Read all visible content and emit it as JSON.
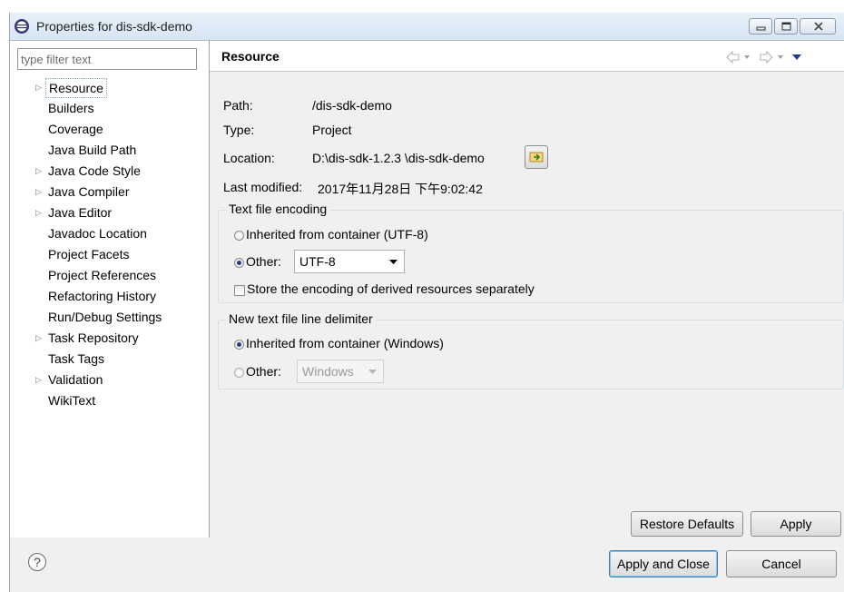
{
  "window": {
    "title": "Properties for dis-sdk-demo"
  },
  "filter": {
    "placeholder": "type filter text"
  },
  "tree": [
    {
      "label": "Resource",
      "expandable": true,
      "selected": true
    },
    {
      "label": "Builders",
      "expandable": false
    },
    {
      "label": "Coverage",
      "expandable": false
    },
    {
      "label": "Java Build Path",
      "expandable": false
    },
    {
      "label": "Java Code Style",
      "expandable": true
    },
    {
      "label": "Java Compiler",
      "expandable": true
    },
    {
      "label": "Java Editor",
      "expandable": true
    },
    {
      "label": "Javadoc Location",
      "expandable": false
    },
    {
      "label": "Project Facets",
      "expandable": false
    },
    {
      "label": "Project References",
      "expandable": false
    },
    {
      "label": "Refactoring History",
      "expandable": false
    },
    {
      "label": "Run/Debug Settings",
      "expandable": false
    },
    {
      "label": "Task Repository",
      "expandable": true
    },
    {
      "label": "Task Tags",
      "expandable": false
    },
    {
      "label": "Validation",
      "expandable": true
    },
    {
      "label": "WikiText",
      "expandable": false
    }
  ],
  "page": {
    "title": "Resource"
  },
  "info": {
    "path_label": "Path:",
    "path_value": "/dis-sdk-demo",
    "type_label": "Type:",
    "type_value": "Project",
    "location_label": "Location:",
    "location_value": "D:\\dis-sdk-1.2.3 \\dis-sdk-demo",
    "modified_label": "Last modified:",
    "modified_value": "2017年11月28日 下午9:02:42"
  },
  "encoding": {
    "legend": "Text file encoding",
    "inherited_label": "Inherited from container (UTF-8)",
    "other_label": "Other:",
    "other_value": "UTF-8",
    "selected": "other",
    "store_label": "Store the encoding of derived resources separately",
    "store_checked": false
  },
  "delimiter": {
    "legend": "New text file line delimiter",
    "inherited_label": "Inherited from container (Windows)",
    "other_label": "Other:",
    "other_value": "Windows",
    "selected": "inherited"
  },
  "buttons": {
    "restore_defaults": "Restore Defaults",
    "apply": "Apply",
    "apply_and_close": "Apply and Close",
    "cancel": "Cancel"
  },
  "help": {
    "symbol": "?"
  },
  "colors": {
    "accent": "#3c7fb1",
    "radio_dot": "#1d3f8a"
  }
}
